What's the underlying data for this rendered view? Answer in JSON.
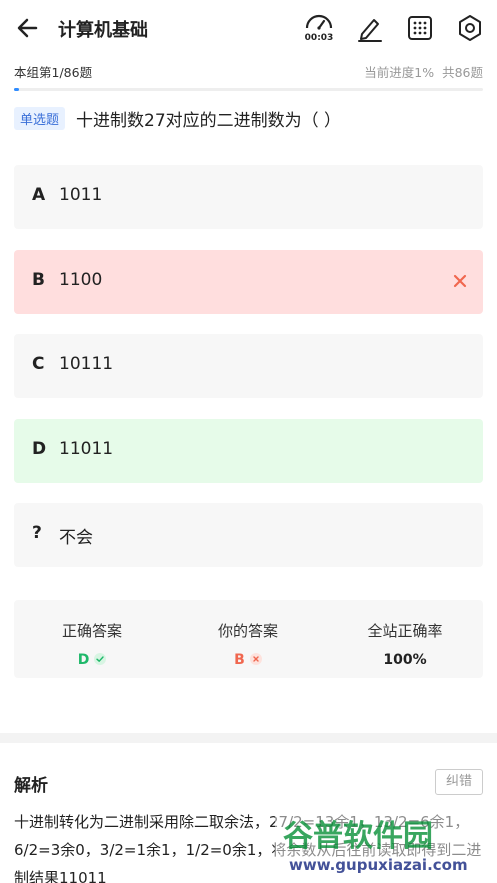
{
  "header": {
    "title": "计算机基础",
    "timer": "00:03"
  },
  "progress": {
    "group_label": "本组第1/86题",
    "current_progress": "当前进度1%",
    "total": "共86题",
    "value": 0.01
  },
  "question": {
    "type_tag": "单选题",
    "text": "十进制数27对应的二进制数为（ ）"
  },
  "options": [
    {
      "letter": "A",
      "text": "1011",
      "state": "normal"
    },
    {
      "letter": "B",
      "text": "1100",
      "state": "wrong"
    },
    {
      "letter": "C",
      "text": "10111",
      "state": "normal"
    },
    {
      "letter": "D",
      "text": "11011",
      "state": "correct"
    },
    {
      "letter": "?",
      "text": "不会",
      "state": "normal"
    }
  ],
  "stats": {
    "correct_label": "正确答案",
    "correct_value": "D",
    "yours_label": "你的答案",
    "yours_value": "B",
    "rate_label": "全站正确率",
    "rate_value": "100%"
  },
  "explanation": {
    "title": "解析",
    "report_button": "纠错",
    "body": "十进制转化为二进制采用除二取余法，27/2=13余1，13/2=6余1，6/2=3余0，3/2=1余1，1/2=0余1，将余数从后往前读取即得到二进制结果11011"
  },
  "watermark": {
    "cn": "谷普软件园",
    "url": "www.gupuxiazai.com"
  },
  "colors": {
    "accent": "#2f8cff",
    "wrong_bg": "#ffdede",
    "correct_bg": "#e6fbe9",
    "correct_text": "#1fb86a",
    "wrong_text": "#f0674f"
  }
}
